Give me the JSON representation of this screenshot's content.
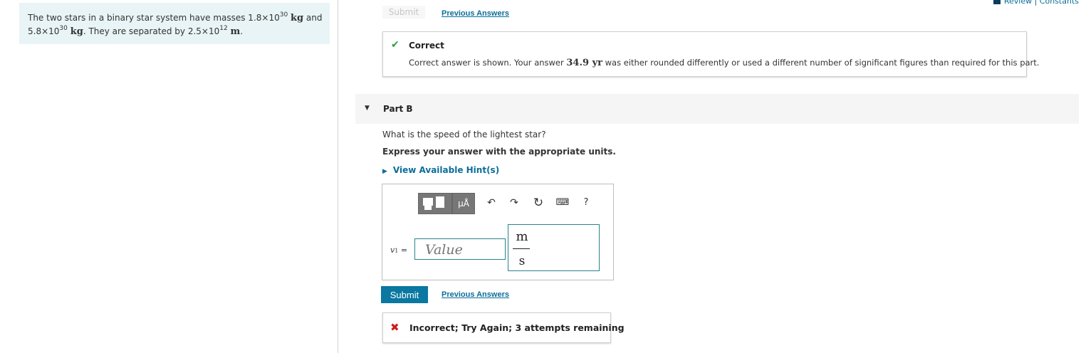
{
  "problem": {
    "intro": "The two stars in a binary star system have masses 1.8×10",
    "mass1_exp": "30",
    "unit_kg": "kg",
    "and_text": " and",
    "mass2": "5.8×10",
    "mass2_exp": "30",
    "unit_kg2": "kg",
    "separation_text": ". They are separated by 2.5×10",
    "sep_exp": "12",
    "unit_m": "m",
    "period": "."
  },
  "header": {
    "review_label": "Review | Constants"
  },
  "part_a": {
    "submit_label": "Submit",
    "previous_answers": "Previous Answers",
    "feedback_title": "Correct",
    "feedback_pre": "Correct answer is shown. Your answer ",
    "feedback_value": "34.9 yr",
    "feedback_post": " was either rounded differently or used a different number of significant figures than required for this part."
  },
  "part_b": {
    "title": "Part B",
    "question": "What is the speed of the lightest star?",
    "instruction": "Express your answer with the appropriate units.",
    "hints_label": "View Available Hint(s)",
    "toolbar": {
      "units_label": "μÅ",
      "help_label": "?",
      "icons": [
        "templates-icon",
        "units-icon",
        "undo-icon",
        "redo-icon",
        "reset-icon",
        "keyboard-icon",
        "help-icon"
      ]
    },
    "variable": "v",
    "variable_sub": "1",
    "equals": "=",
    "value_placeholder": "Value",
    "unit_numerator": "m",
    "unit_denominator": "s",
    "submit_label": "Submit",
    "previous_answers": "Previous Answers",
    "feedback": "Incorrect; Try Again; 3 attempts remaining"
  },
  "colors": {
    "accent": "#0a78a0",
    "correct": "#2e9e3f",
    "incorrect": "#d01c1c",
    "panel_bg": "#e8f4f6"
  }
}
